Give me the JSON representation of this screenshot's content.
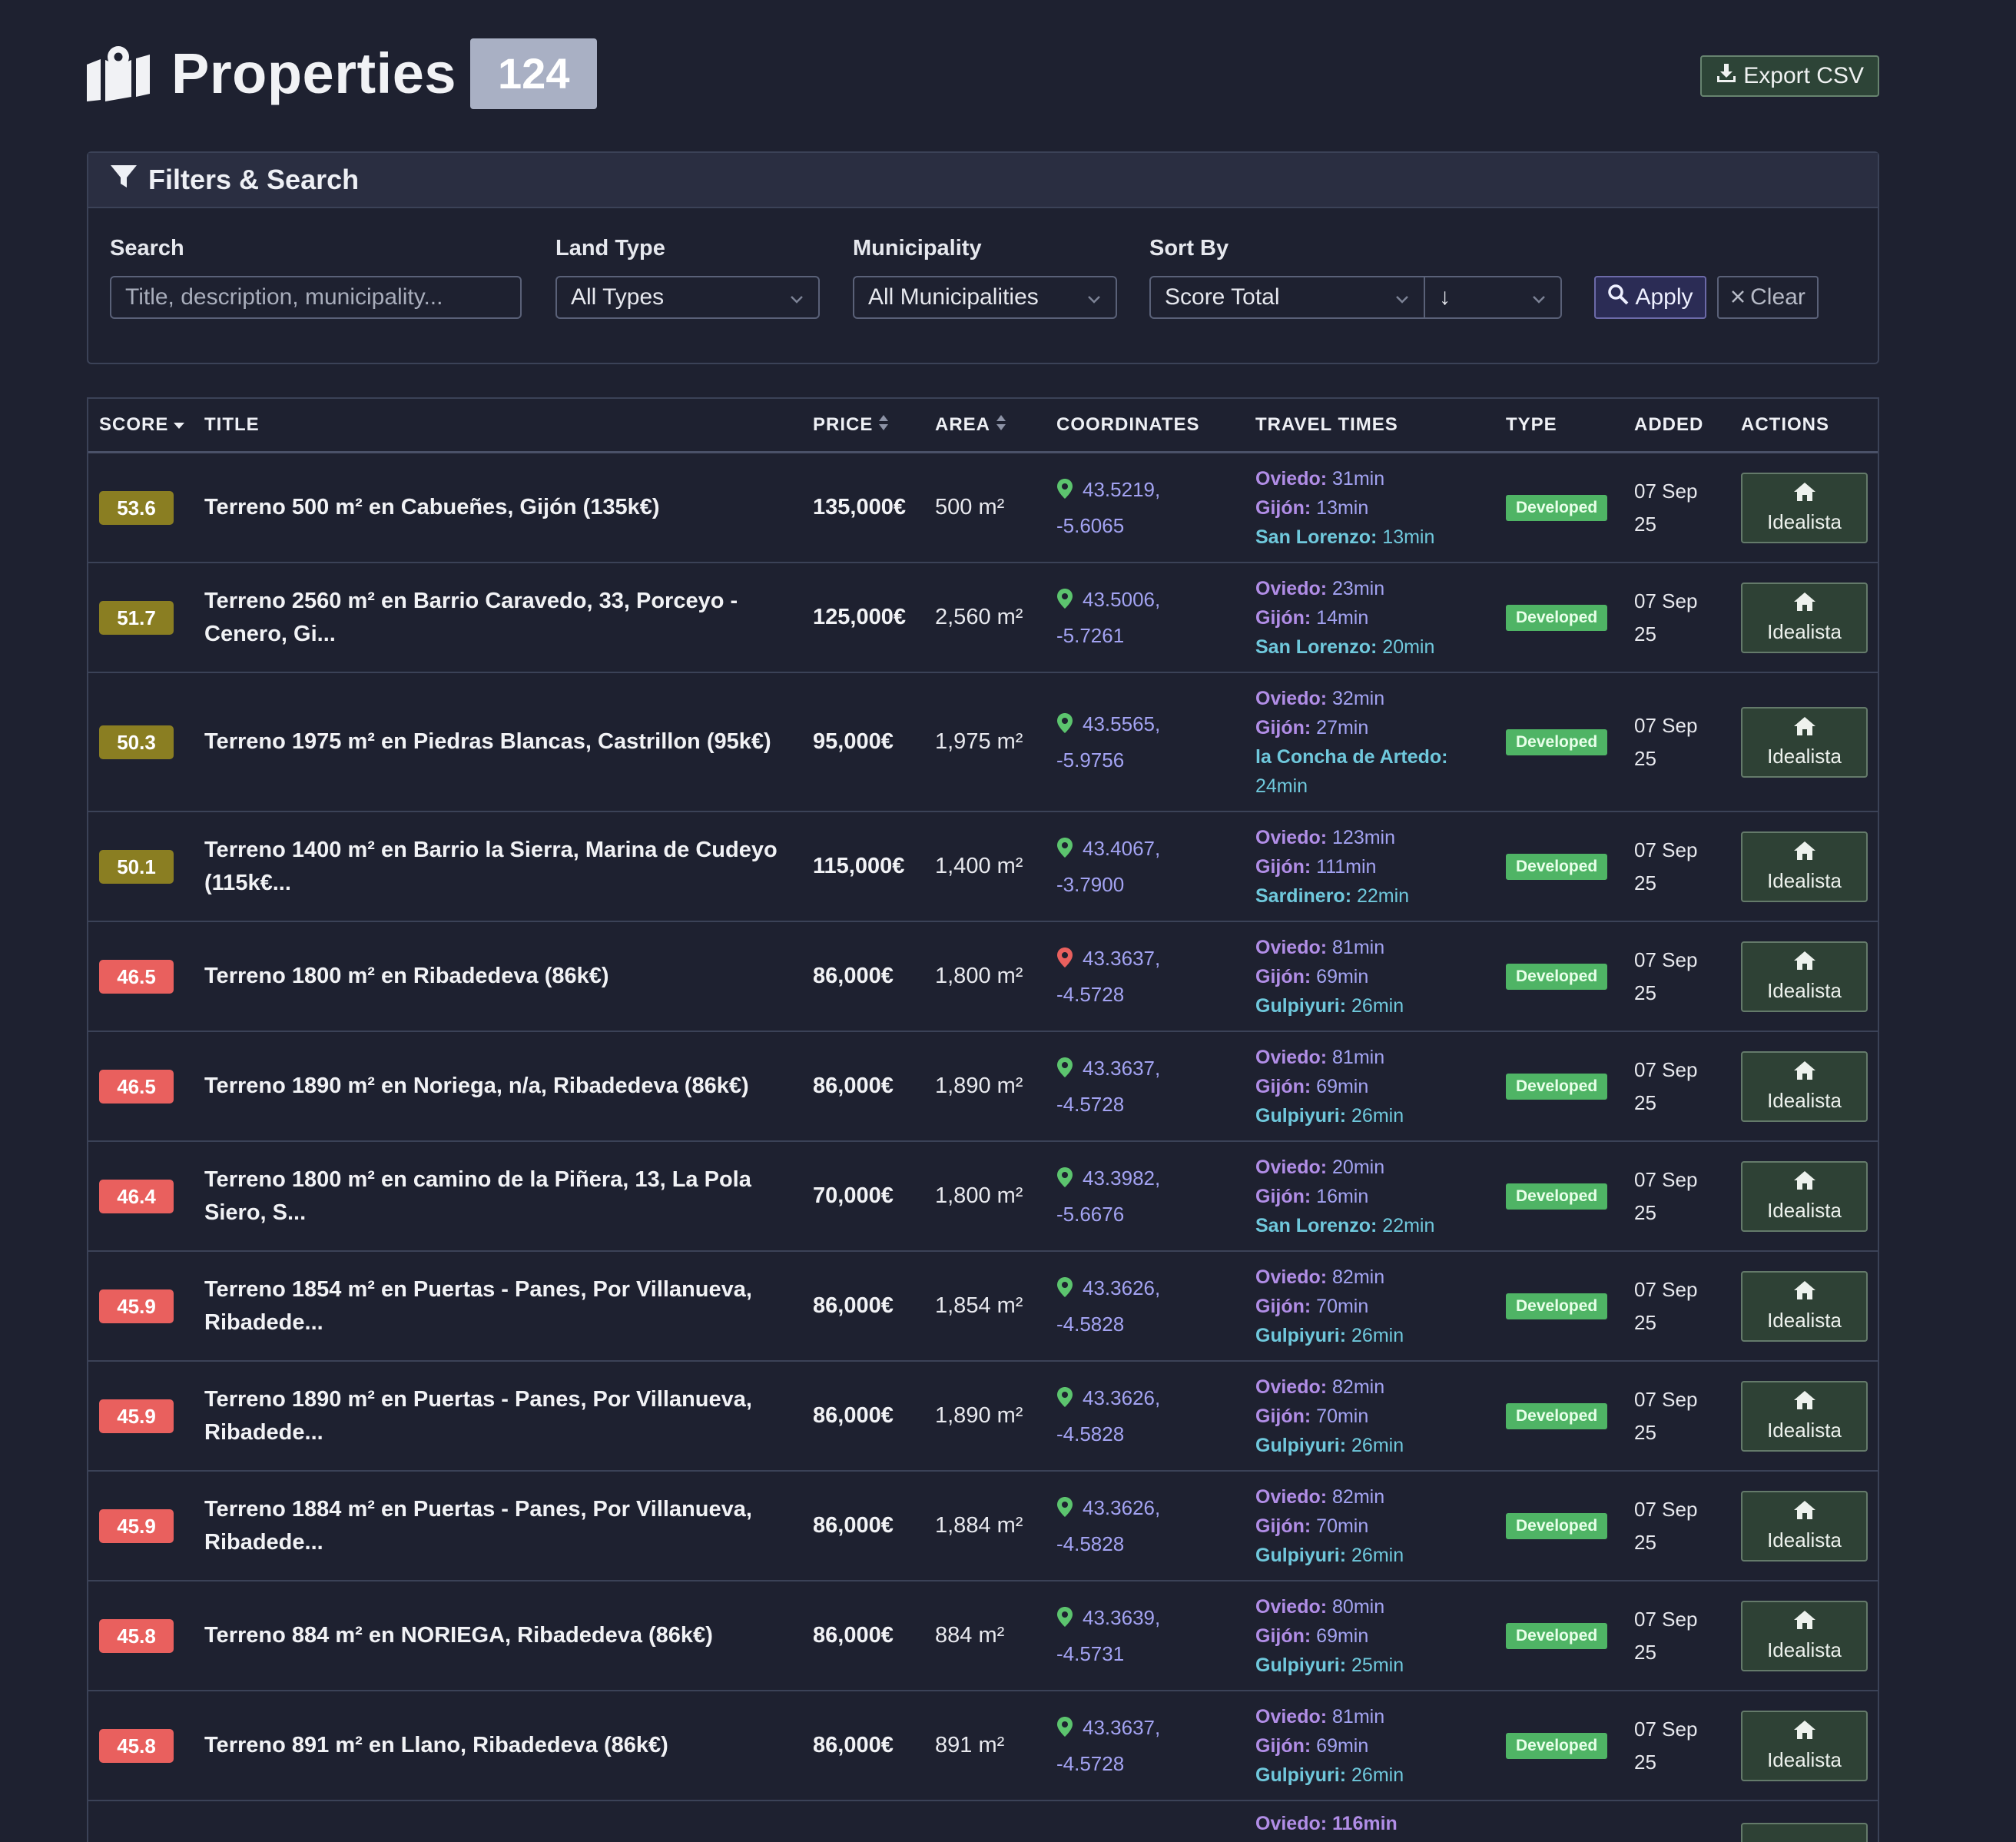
{
  "header": {
    "title": "Properties",
    "count": "124",
    "export_label": "Export CSV"
  },
  "filters": {
    "title": "Filters & Search",
    "search_label": "Search",
    "search_placeholder": "Title, description, municipality...",
    "land_type_label": "Land Type",
    "land_type_value": "All Types",
    "municipality_label": "Municipality",
    "municipality_value": "All Municipalities",
    "sort_label": "Sort By",
    "sort_value": "Score Total",
    "sort_dir": "↓",
    "apply_label": "Apply",
    "clear_label": "Clear"
  },
  "table": {
    "headers": {
      "score": "SCORE",
      "title": "TITLE",
      "price": "PRICE",
      "area": "AREA",
      "coordinates": "COORDINATES",
      "travel": "TRAVEL TIMES",
      "type": "TYPE",
      "added": "ADDED",
      "actions": "ACTIONS"
    },
    "colors": {
      "score_high": "#8a7e22",
      "score_mid": "#e9605e",
      "pin_green": "#5cc46e",
      "pin_red": "#e9605e"
    },
    "rows": [
      {
        "score": "53.6",
        "score_level": "gold",
        "title1": "Terreno 500 m² en Cabueñes, Gijón (135k€)",
        "title2": "",
        "price": "135,000€",
        "area": "500 m²",
        "lat": "43.5219,",
        "lng": "-5.6065",
        "pin": "green",
        "t1_city": "Oviedo:",
        "t1_time": " 31min",
        "t2_city": "Gijón:",
        "t2_time": " 13min",
        "t3": "San Lorenzo:",
        "t3_time": " 13min",
        "t4": "",
        "type": "Developed",
        "added_a": "07 Sep",
        "added_b": "25",
        "action": "Idealista"
      },
      {
        "score": "51.7",
        "score_level": "gold",
        "title1": "Terreno 2560 m² en Barrio Caravedo, 33, Porceyo -",
        "title2": "Cenero, Gi...",
        "price": "125,000€",
        "area": "2,560 m²",
        "lat": "43.5006,",
        "lng": "-5.7261",
        "pin": "green",
        "t1_city": "Oviedo:",
        "t1_time": " 23min",
        "t2_city": "Gijón:",
        "t2_time": " 14min",
        "t3": "San Lorenzo:",
        "t3_time": " 20min",
        "t4": "",
        "type": "Developed",
        "added_a": "07 Sep",
        "added_b": "25",
        "action": "Idealista"
      },
      {
        "score": "50.3",
        "score_level": "gold",
        "title1": "Terreno 1975 m² en Piedras Blancas, Castrillon (95k€)",
        "title2": "",
        "price": "95,000€",
        "area": "1,975 m²",
        "lat": "43.5565,",
        "lng": "-5.9756",
        "pin": "green",
        "t1_city": "Oviedo:",
        "t1_time": " 32min",
        "t2_city": "Gijón:",
        "t2_time": " 27min",
        "t3": "la Concha de Artedo:",
        "t3_time": "",
        "t4": "24min",
        "type": "Developed",
        "added_a": "07 Sep",
        "added_b": "25",
        "action": "Idealista"
      },
      {
        "score": "50.1",
        "score_level": "gold",
        "title1": "Terreno 1400 m² en Barrio la Sierra, Marina de Cudeyo",
        "title2": "(115k€...",
        "price": "115,000€",
        "area": "1,400 m²",
        "lat": "43.4067,",
        "lng": "-3.7900",
        "pin": "green",
        "t1_city": "Oviedo:",
        "t1_time": " 123min",
        "t2_city": "Gijón:",
        "t2_time": " 111min",
        "t3": "Sardinero:",
        "t3_time": " 22min",
        "t4": "",
        "type": "Developed",
        "added_a": "07 Sep",
        "added_b": "25",
        "action": "Idealista"
      },
      {
        "score": "46.5",
        "score_level": "red",
        "title1": "Terreno 1800 m² en Ribadedeva (86k€)",
        "title2": "",
        "price": "86,000€",
        "area": "1,800 m²",
        "lat": "43.3637,",
        "lng": "-4.5728",
        "pin": "red",
        "t1_city": "Oviedo:",
        "t1_time": " 81min",
        "t2_city": "Gijón:",
        "t2_time": " 69min",
        "t3": "Gulpiyuri:",
        "t3_time": " 26min",
        "t4": "",
        "type": "Developed",
        "added_a": "07 Sep",
        "added_b": "25",
        "action": "Idealista"
      },
      {
        "score": "46.5",
        "score_level": "red",
        "title1": "Terreno 1890 m² en Noriega, n/a, Ribadedeva (86k€)",
        "title2": "",
        "price": "86,000€",
        "area": "1,890 m²",
        "lat": "43.3637,",
        "lng": "-4.5728",
        "pin": "green",
        "t1_city": "Oviedo:",
        "t1_time": " 81min",
        "t2_city": "Gijón:",
        "t2_time": " 69min",
        "t3": "Gulpiyuri:",
        "t3_time": " 26min",
        "t4": "",
        "type": "Developed",
        "added_a": "07 Sep",
        "added_b": "25",
        "action": "Idealista"
      },
      {
        "score": "46.4",
        "score_level": "red",
        "title1": "Terreno 1800 m² en camino de la Piñera, 13, La Pola",
        "title2": "Siero, S...",
        "price": "70,000€",
        "area": "1,800 m²",
        "lat": "43.3982,",
        "lng": "-5.6676",
        "pin": "green",
        "t1_city": "Oviedo:",
        "t1_time": " 20min",
        "t2_city": "Gijón:",
        "t2_time": " 16min",
        "t3": "San Lorenzo:",
        "t3_time": " 22min",
        "t4": "",
        "type": "Developed",
        "added_a": "07 Sep",
        "added_b": "25",
        "action": "Idealista"
      },
      {
        "score": "45.9",
        "score_level": "red",
        "title1": "Terreno 1854 m² en Puertas - Panes, Por Villanueva,",
        "title2": "Ribadede...",
        "price": "86,000€",
        "area": "1,854 m²",
        "lat": "43.3626,",
        "lng": "-4.5828",
        "pin": "green",
        "t1_city": "Oviedo:",
        "t1_time": " 82min",
        "t2_city": "Gijón:",
        "t2_time": " 70min",
        "t3": "Gulpiyuri:",
        "t3_time": " 26min",
        "t4": "",
        "type": "Developed",
        "added_a": "07 Sep",
        "added_b": "25",
        "action": "Idealista"
      },
      {
        "score": "45.9",
        "score_level": "red",
        "title1": "Terreno 1890 m² en Puertas - Panes, Por Villanueva,",
        "title2": "Ribadede...",
        "price": "86,000€",
        "area": "1,890 m²",
        "lat": "43.3626,",
        "lng": "-4.5828",
        "pin": "green",
        "t1_city": "Oviedo:",
        "t1_time": " 82min",
        "t2_city": "Gijón:",
        "t2_time": " 70min",
        "t3": "Gulpiyuri:",
        "t3_time": " 26min",
        "t4": "",
        "type": "Developed",
        "added_a": "07 Sep",
        "added_b": "25",
        "action": "Idealista"
      },
      {
        "score": "45.9",
        "score_level": "red",
        "title1": "Terreno 1884 m² en Puertas - Panes, Por Villanueva,",
        "title2": "Ribadede...",
        "price": "86,000€",
        "area": "1,884 m²",
        "lat": "43.3626,",
        "lng": "-4.5828",
        "pin": "green",
        "t1_city": "Oviedo:",
        "t1_time": " 82min",
        "t2_city": "Gijón:",
        "t2_time": " 70min",
        "t3": "Gulpiyuri:",
        "t3_time": " 26min",
        "t4": "",
        "type": "Developed",
        "added_a": "07 Sep",
        "added_b": "25",
        "action": "Idealista"
      },
      {
        "score": "45.8",
        "score_level": "red",
        "title1": "Terreno 884 m² en NORIEGA, Ribadedeva (86k€)",
        "title2": "",
        "price": "86,000€",
        "area": "884 m²",
        "lat": "43.3639,",
        "lng": "-4.5731",
        "pin": "green",
        "t1_city": "Oviedo:",
        "t1_time": " 80min",
        "t2_city": "Gijón:",
        "t2_time": " 69min",
        "t3": "Gulpiyuri:",
        "t3_time": " 25min",
        "t4": "",
        "type": "Developed",
        "added_a": "07 Sep",
        "added_b": "25",
        "action": "Idealista"
      },
      {
        "score": "45.8",
        "score_level": "red",
        "title1": "Terreno 891 m² en Llano, Ribadedeva (86k€)",
        "title2": "",
        "price": "86,000€",
        "area": "891 m²",
        "lat": "43.3637,",
        "lng": "-4.5728",
        "pin": "green",
        "t1_city": "Oviedo:",
        "t1_time": " 81min",
        "t2_city": "Gijón:",
        "t2_time": " 69min",
        "t3": "Gulpiyuri:",
        "t3_time": " 26min",
        "t4": "",
        "type": "Developed",
        "added_a": "07 Sep",
        "added_b": "25",
        "action": "Idealista"
      }
    ],
    "partial_row_travel": "Oviedo: 116min"
  }
}
